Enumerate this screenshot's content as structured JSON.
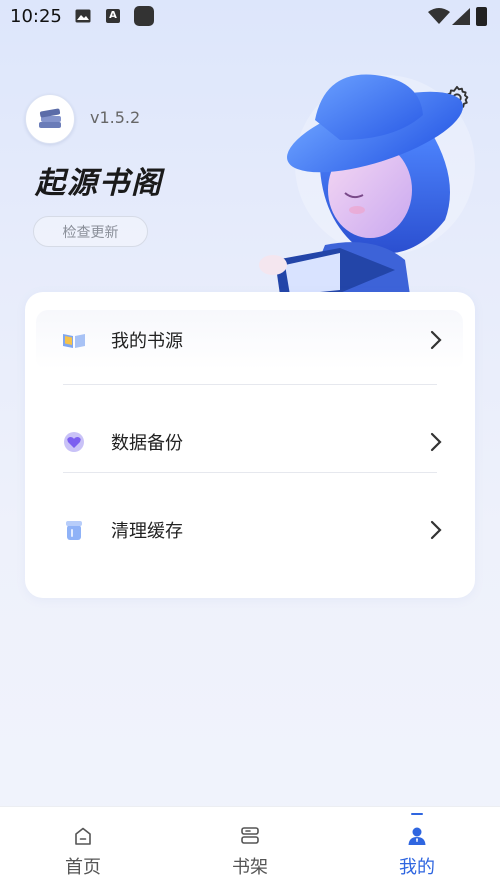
{
  "status_bar": {
    "time": "10:25",
    "icons": [
      "image-icon",
      "a-icon",
      "app-square-icon",
      "wifi-icon",
      "signal-icon",
      "battery-icon"
    ]
  },
  "header": {
    "version": "v1.5.2",
    "title": "起源书阁",
    "update_button": "检查更新",
    "settings_icon": "gear-icon"
  },
  "menu": {
    "items": [
      {
        "label": "我的书源",
        "icon": "open-book-icon"
      },
      {
        "label": "数据备份",
        "icon": "heart-backup-icon"
      },
      {
        "label": "清理缓存",
        "icon": "trash-can-icon"
      }
    ]
  },
  "bottom_nav": {
    "items": [
      {
        "label": "首页",
        "icon": "home-icon",
        "active": false
      },
      {
        "label": "书架",
        "icon": "bookshelf-icon",
        "active": false
      },
      {
        "label": "我的",
        "icon": "user-icon",
        "active": true
      }
    ]
  },
  "colors": {
    "accent": "#2f66e0",
    "background_top": "#dde6fb",
    "card": "#ffffff"
  }
}
